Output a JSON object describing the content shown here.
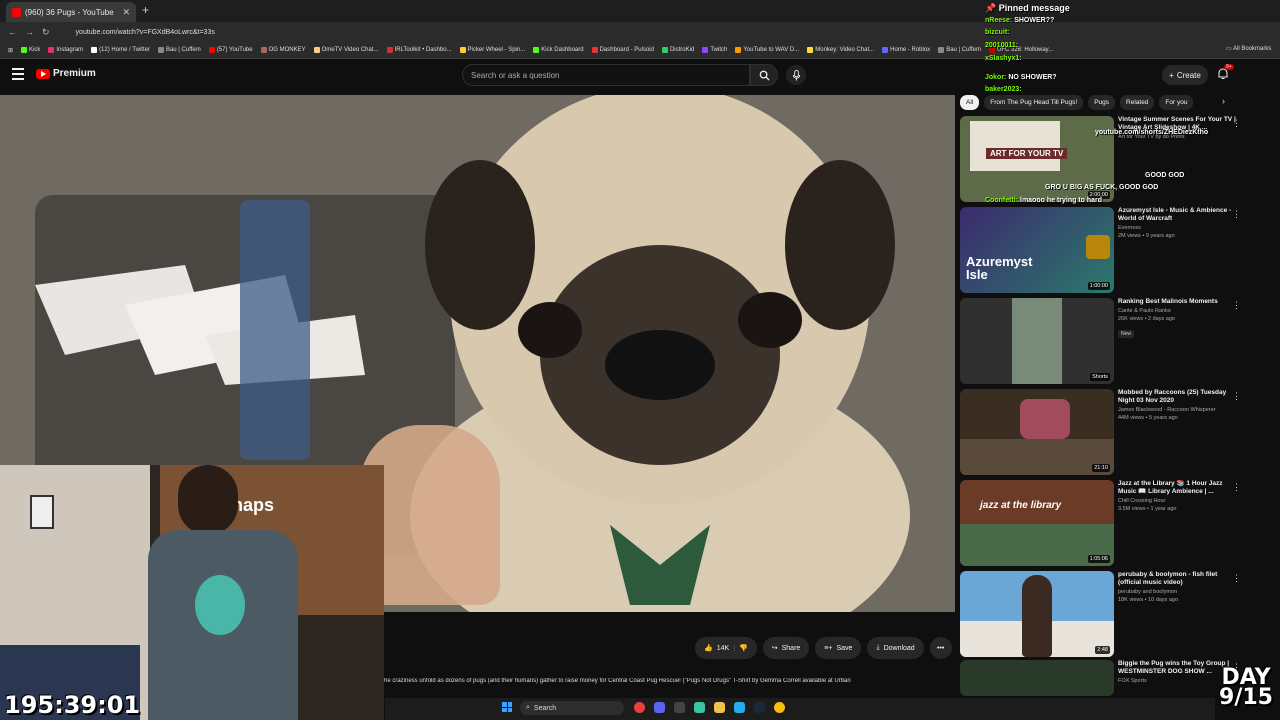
{
  "browser": {
    "tab_title": "(960) 36 Pugs - YouTube",
    "url": "youtube.com/watch?v=FGXdB4oLwrc&t=33s",
    "bookmarks": [
      "Kick",
      "Instagram",
      "(12) Home / Twitter",
      "Bau | Cuffem",
      "(57) YouTube",
      "OG MONKEY",
      "OmeTV Video Chat...",
      "IRLToolkit • Dashbo...",
      "Picker Wheel - Spin...",
      "Kick Dashboard",
      "Dashboard - Pulsoid",
      "DistroKid",
      "Twitch",
      "YouTube to WAV D...",
      "Monkey: Video Chat...",
      "Home - Roblox",
      "Bau | Cuffem",
      "UFC 326: Holloway..."
    ],
    "all_bookmarks": "All Bookmarks"
  },
  "youtube": {
    "brand": "Premium",
    "search_placeholder": "Search or ask a question",
    "create_label": "Create",
    "notif_count": "9+",
    "actions": {
      "likes": "14K",
      "share": "Share",
      "save": "Save",
      "download": "Download"
    },
    "description": "he craziness unfold as dozens of pugs (and their humans) gather to raise money for Central Coast Pug Rescue! (\"Pugs Not Drugs\" T-Shirt by Gemma Correll available at Urban",
    "chips": [
      "All",
      "From The Pug Head Till Pugs!",
      "Pugs",
      "Related",
      "For you"
    ],
    "recommendations": [
      {
        "title": "Vintage Summer Scenes For Your TV | Vintage Art Slideshow | 4K ...",
        "channel": "Art for Your TV by 88 Prints",
        "meta": "",
        "duration": "2:00:00",
        "thumb_text": "ART FOR YOUR TV"
      },
      {
        "title": "Azuremyst Isle - Music & Ambience - World of Warcraft",
        "channel": "Everness",
        "meta": "2M views • 9 years ago",
        "duration": "1:00:00",
        "thumb_text": "Azuremyst Isle"
      },
      {
        "title": "Ranking Best Malinois Moments",
        "channel": "Cante & Paulo Ranks",
        "meta": "26K views • 2 days ago",
        "badge": "New",
        "duration": "Shorts",
        "thumb_text": ""
      },
      {
        "title": "Mobbed by Raccoons (25) Tuesday Night 03 Nov 2020",
        "channel": "James Blackwood - Raccoon Whisperer",
        "meta": "44M views • 5 years ago",
        "duration": "21:10",
        "thumb_text": ""
      },
      {
        "title": "Jazz at the Library 📚 1 Hour Jazz Music 📖 Library Ambience | ...",
        "channel": "Chill Crossing Hour",
        "meta": "3.5M views • 1 year ago",
        "duration": "1:05:06",
        "thumb_text": "jazz at the library"
      },
      {
        "title": "perubaby & boolymon - fish filet (official music video)",
        "channel": "perubaby and boolymon",
        "meta": "18K views • 10 days ago",
        "duration": "2:48",
        "thumb_text": ""
      },
      {
        "title": "Biggie the Pug wins the Toy Group | WESTMINSTER DOG SHOW ...",
        "channel": "FOX Sports",
        "meta": "",
        "duration": "",
        "thumb_text": ""
      }
    ]
  },
  "chat": {
    "pinned": "Pinned message",
    "messages": [
      {
        "user": "nReese:",
        "text": "SHOWER??"
      },
      {
        "user": "bizcuit:",
        "text": ""
      },
      {
        "user": "",
        "text": ""
      },
      {
        "user": "20010011:",
        "text": ""
      },
      {
        "user": "xSlashyx1:",
        "text": ""
      },
      {
        "user": "Jokor:",
        "text": "NO SHOWER?"
      },
      {
        "user": "baker2023:",
        "text": ""
      },
      {
        "user": "",
        "text": "youtube.com/shorts/ZHEDiezKtho"
      },
      {
        "user": "",
        "text": "GOOD GOD"
      },
      {
        "user": "",
        "text": "GRO U BIG AS FUCK, GOOD GOD"
      },
      {
        "user": "Coonfetti:",
        "text": "lmaooo he trying to hard"
      }
    ]
  },
  "overlay": {
    "timer": "195:39:01",
    "day": "DAY",
    "day_count": "9/15",
    "cam_text": "naps"
  },
  "taskbar": {
    "search": "Search"
  },
  "colors": {
    "youtube_red": "#ff0000",
    "chat_user": "#7cfc00"
  }
}
